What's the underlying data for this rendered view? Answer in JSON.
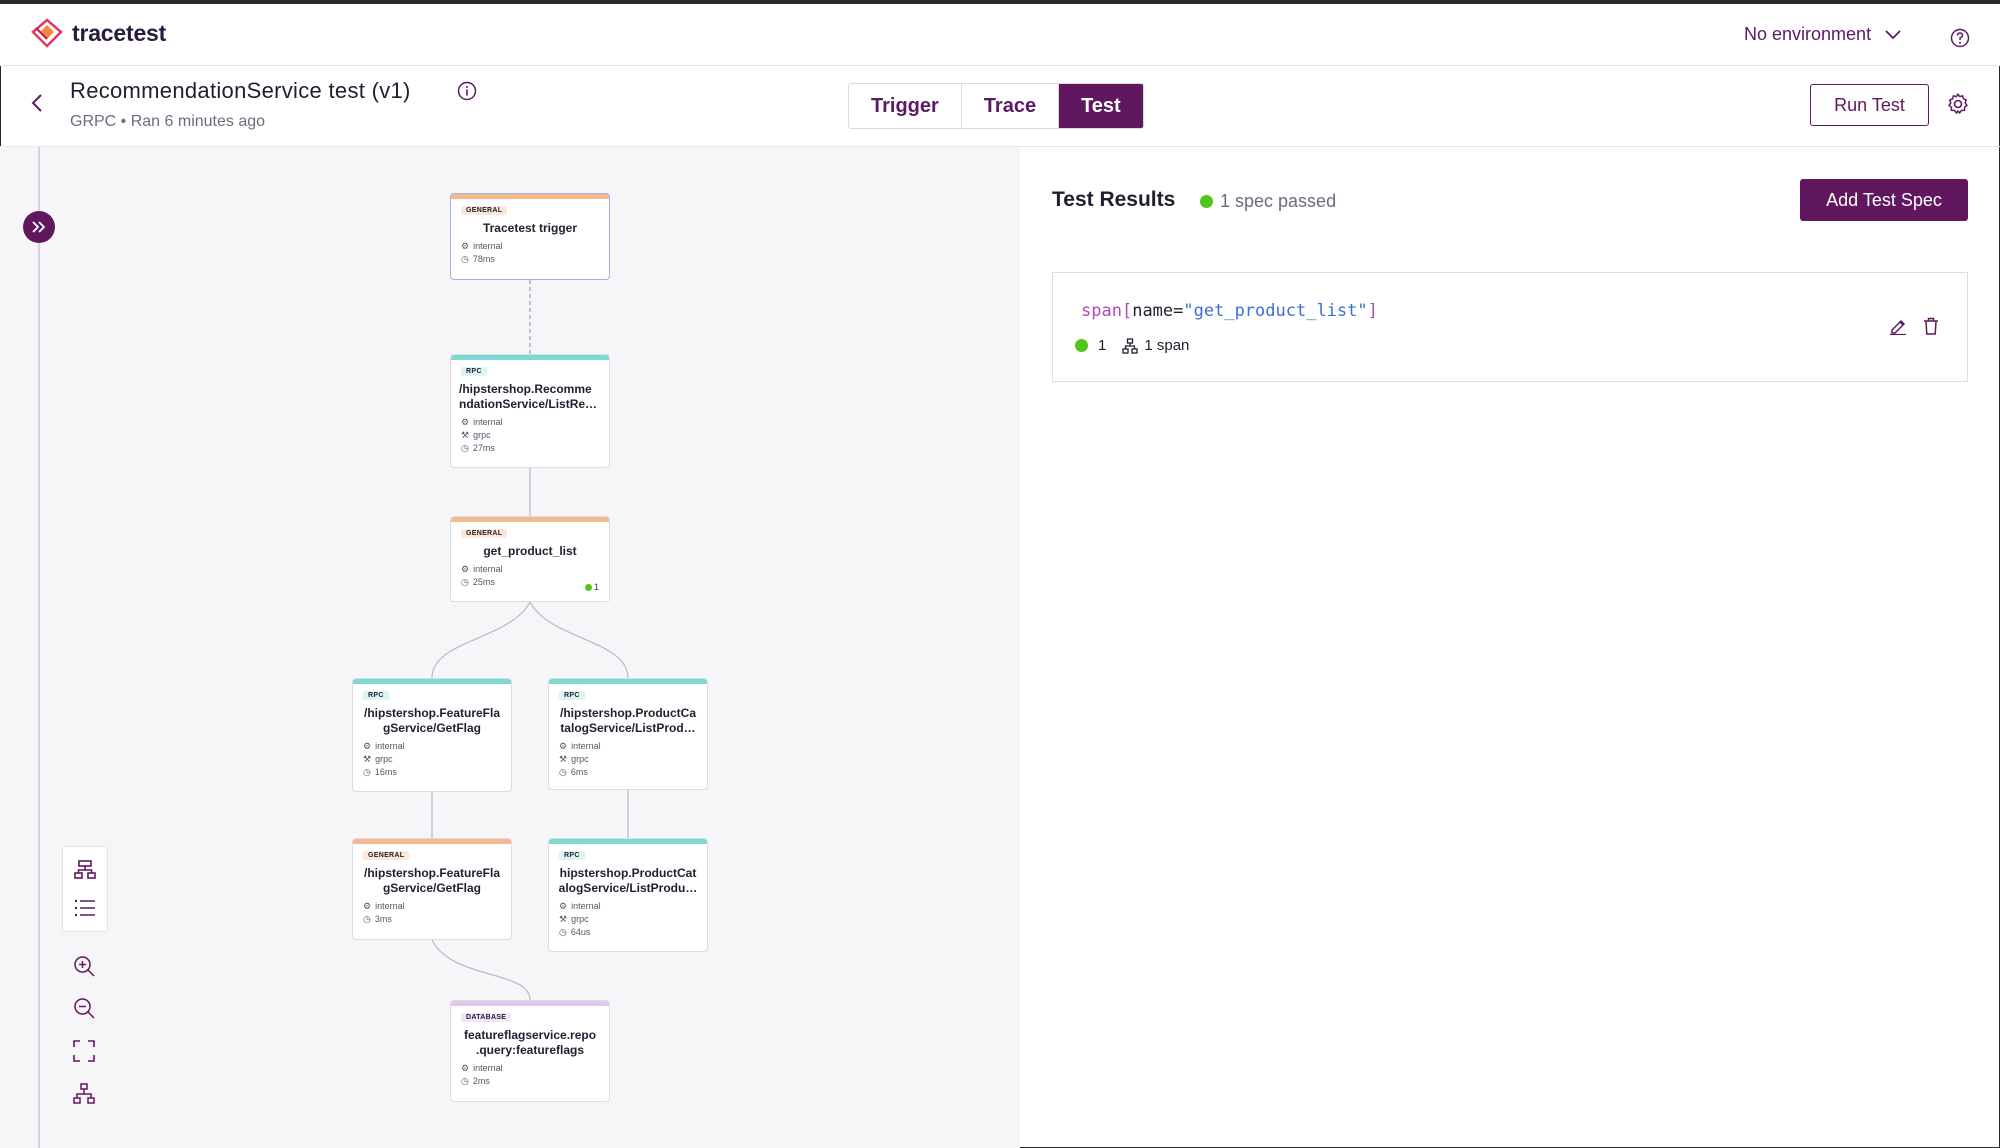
{
  "app": {
    "logo_text": "tracetest",
    "environment": "No environment"
  },
  "header": {
    "title": "RecommendationService test (v1)",
    "subtitle": "GRPC • Ran 6 minutes ago",
    "tabs": [
      {
        "label": "Trigger"
      },
      {
        "label": "Trace"
      },
      {
        "label": "Test"
      }
    ],
    "active_tab": "Test",
    "run_button": "Run Test"
  },
  "graph": {
    "nodes": [
      {
        "type": "GENERAL",
        "name": "Tracetest trigger",
        "attrs": [
          "internal",
          "78ms"
        ]
      },
      {
        "type": "RPC",
        "name": "/hipstershop.Recomme ndationService/ListRe…",
        "attrs": [
          "internal",
          "grpc",
          "27ms"
        ]
      },
      {
        "type": "GENERAL",
        "name": "get_product_list",
        "attrs": [
          "internal",
          "25ms"
        ],
        "check_count": "1"
      },
      {
        "type": "RPC",
        "name": "/hipstershop.FeatureFla gService/GetFlag",
        "attrs": [
          "internal",
          "grpc",
          "16ms"
        ]
      },
      {
        "type": "RPC",
        "name": "/hipstershop.ProductCa talogService/ListProd…",
        "attrs": [
          "internal",
          "grpc",
          "6ms"
        ]
      },
      {
        "type": "GENERAL",
        "name": "/hipstershop.FeatureFla gService/GetFlag",
        "attrs": [
          "internal",
          "3ms"
        ]
      },
      {
        "type": "RPC",
        "name": "hipstershop.ProductCat alogService/ListProdu…",
        "attrs": [
          "internal",
          "grpc",
          "64us"
        ]
      },
      {
        "type": "DATABASE",
        "name": "featureflagservice.repo .query:featureflags",
        "attrs": [
          "internal",
          "2ms"
        ]
      }
    ]
  },
  "results": {
    "title": "Test Results",
    "status": "1 spec passed",
    "add_button": "Add Test Spec",
    "spec": {
      "selector_kw": "span",
      "selector_open": "[",
      "selector_attr": "name=",
      "selector_value": "\"get_product_list\"",
      "selector_close": "]",
      "passed_count": "1",
      "span_count": "1 span"
    }
  },
  "colors": {
    "brand": "#61175e",
    "general": "#f5b88f",
    "rpc": "#7fd9d3",
    "database": "#e2c7f0",
    "pass": "#52c41a"
  }
}
